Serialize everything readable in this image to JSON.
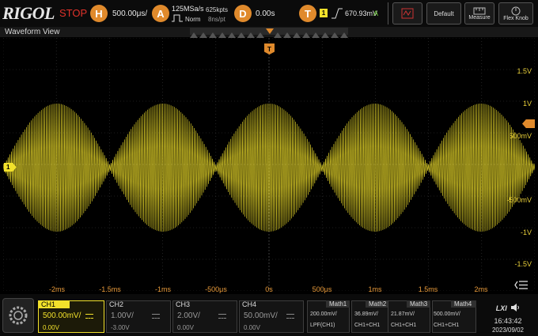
{
  "topbar": {
    "logo": "RIGOL",
    "run_state": "STOP",
    "horizontal": {
      "key": "H",
      "value": "500.00μs/"
    },
    "acquire": {
      "key": "A",
      "sample_rate": "125MSa/s",
      "memory": "625kpts",
      "mode": "Norm",
      "interval": "8ns/pt"
    },
    "delay": {
      "key": "D",
      "value": "0.00s"
    },
    "trigger": {
      "key": "T",
      "source": "1",
      "level": "670.93mV",
      "sweep": "A"
    },
    "buttons": {
      "autoset": "",
      "default": "Default",
      "measure": "Measure",
      "flex_knob": "Flex Knob"
    }
  },
  "waveform_view": {
    "title": "Waveform View",
    "ch1_marker": "1",
    "trigger_marker": "T",
    "y_labels": [
      "1.5V",
      "1V",
      "500mV",
      "-500mV",
      "-1V",
      "-1.5V"
    ],
    "x_labels": [
      "-2ms",
      "-1.5ms",
      "-1ms",
      "-500μs",
      "0s",
      "500μs",
      "1ms",
      "1.5ms",
      "2ms"
    ]
  },
  "channels": [
    {
      "name": "CH1",
      "scale": "500.00mV/",
      "offset": "0.00V",
      "active": true
    },
    {
      "name": "CH2",
      "scale": "1.00V/",
      "offset": "-3.00V",
      "active": false
    },
    {
      "name": "CH3",
      "scale": "2.00V/",
      "offset": "0.00V",
      "active": false
    },
    {
      "name": "CH4",
      "scale": "50.00mV/",
      "offset": "0.00V",
      "active": false
    }
  ],
  "math": [
    {
      "name": "Math1",
      "value": "200.00mV/",
      "source": "LPF(CH1)"
    },
    {
      "name": "Math2",
      "value": "36.89mV/",
      "source": "CH1+CH1"
    },
    {
      "name": "Math3",
      "value": "21.87mV/",
      "source": "CH1+CH1"
    },
    {
      "name": "Math4",
      "value": "500.00mV/",
      "source": "CH1+CH1"
    }
  ],
  "status": {
    "lxi": "LXI",
    "time": "16:43:42",
    "date": "2023/09/02"
  },
  "colors": {
    "ch1": "#f2e12b",
    "trigger": "#e08a2c",
    "stop": "#e0322a"
  }
}
